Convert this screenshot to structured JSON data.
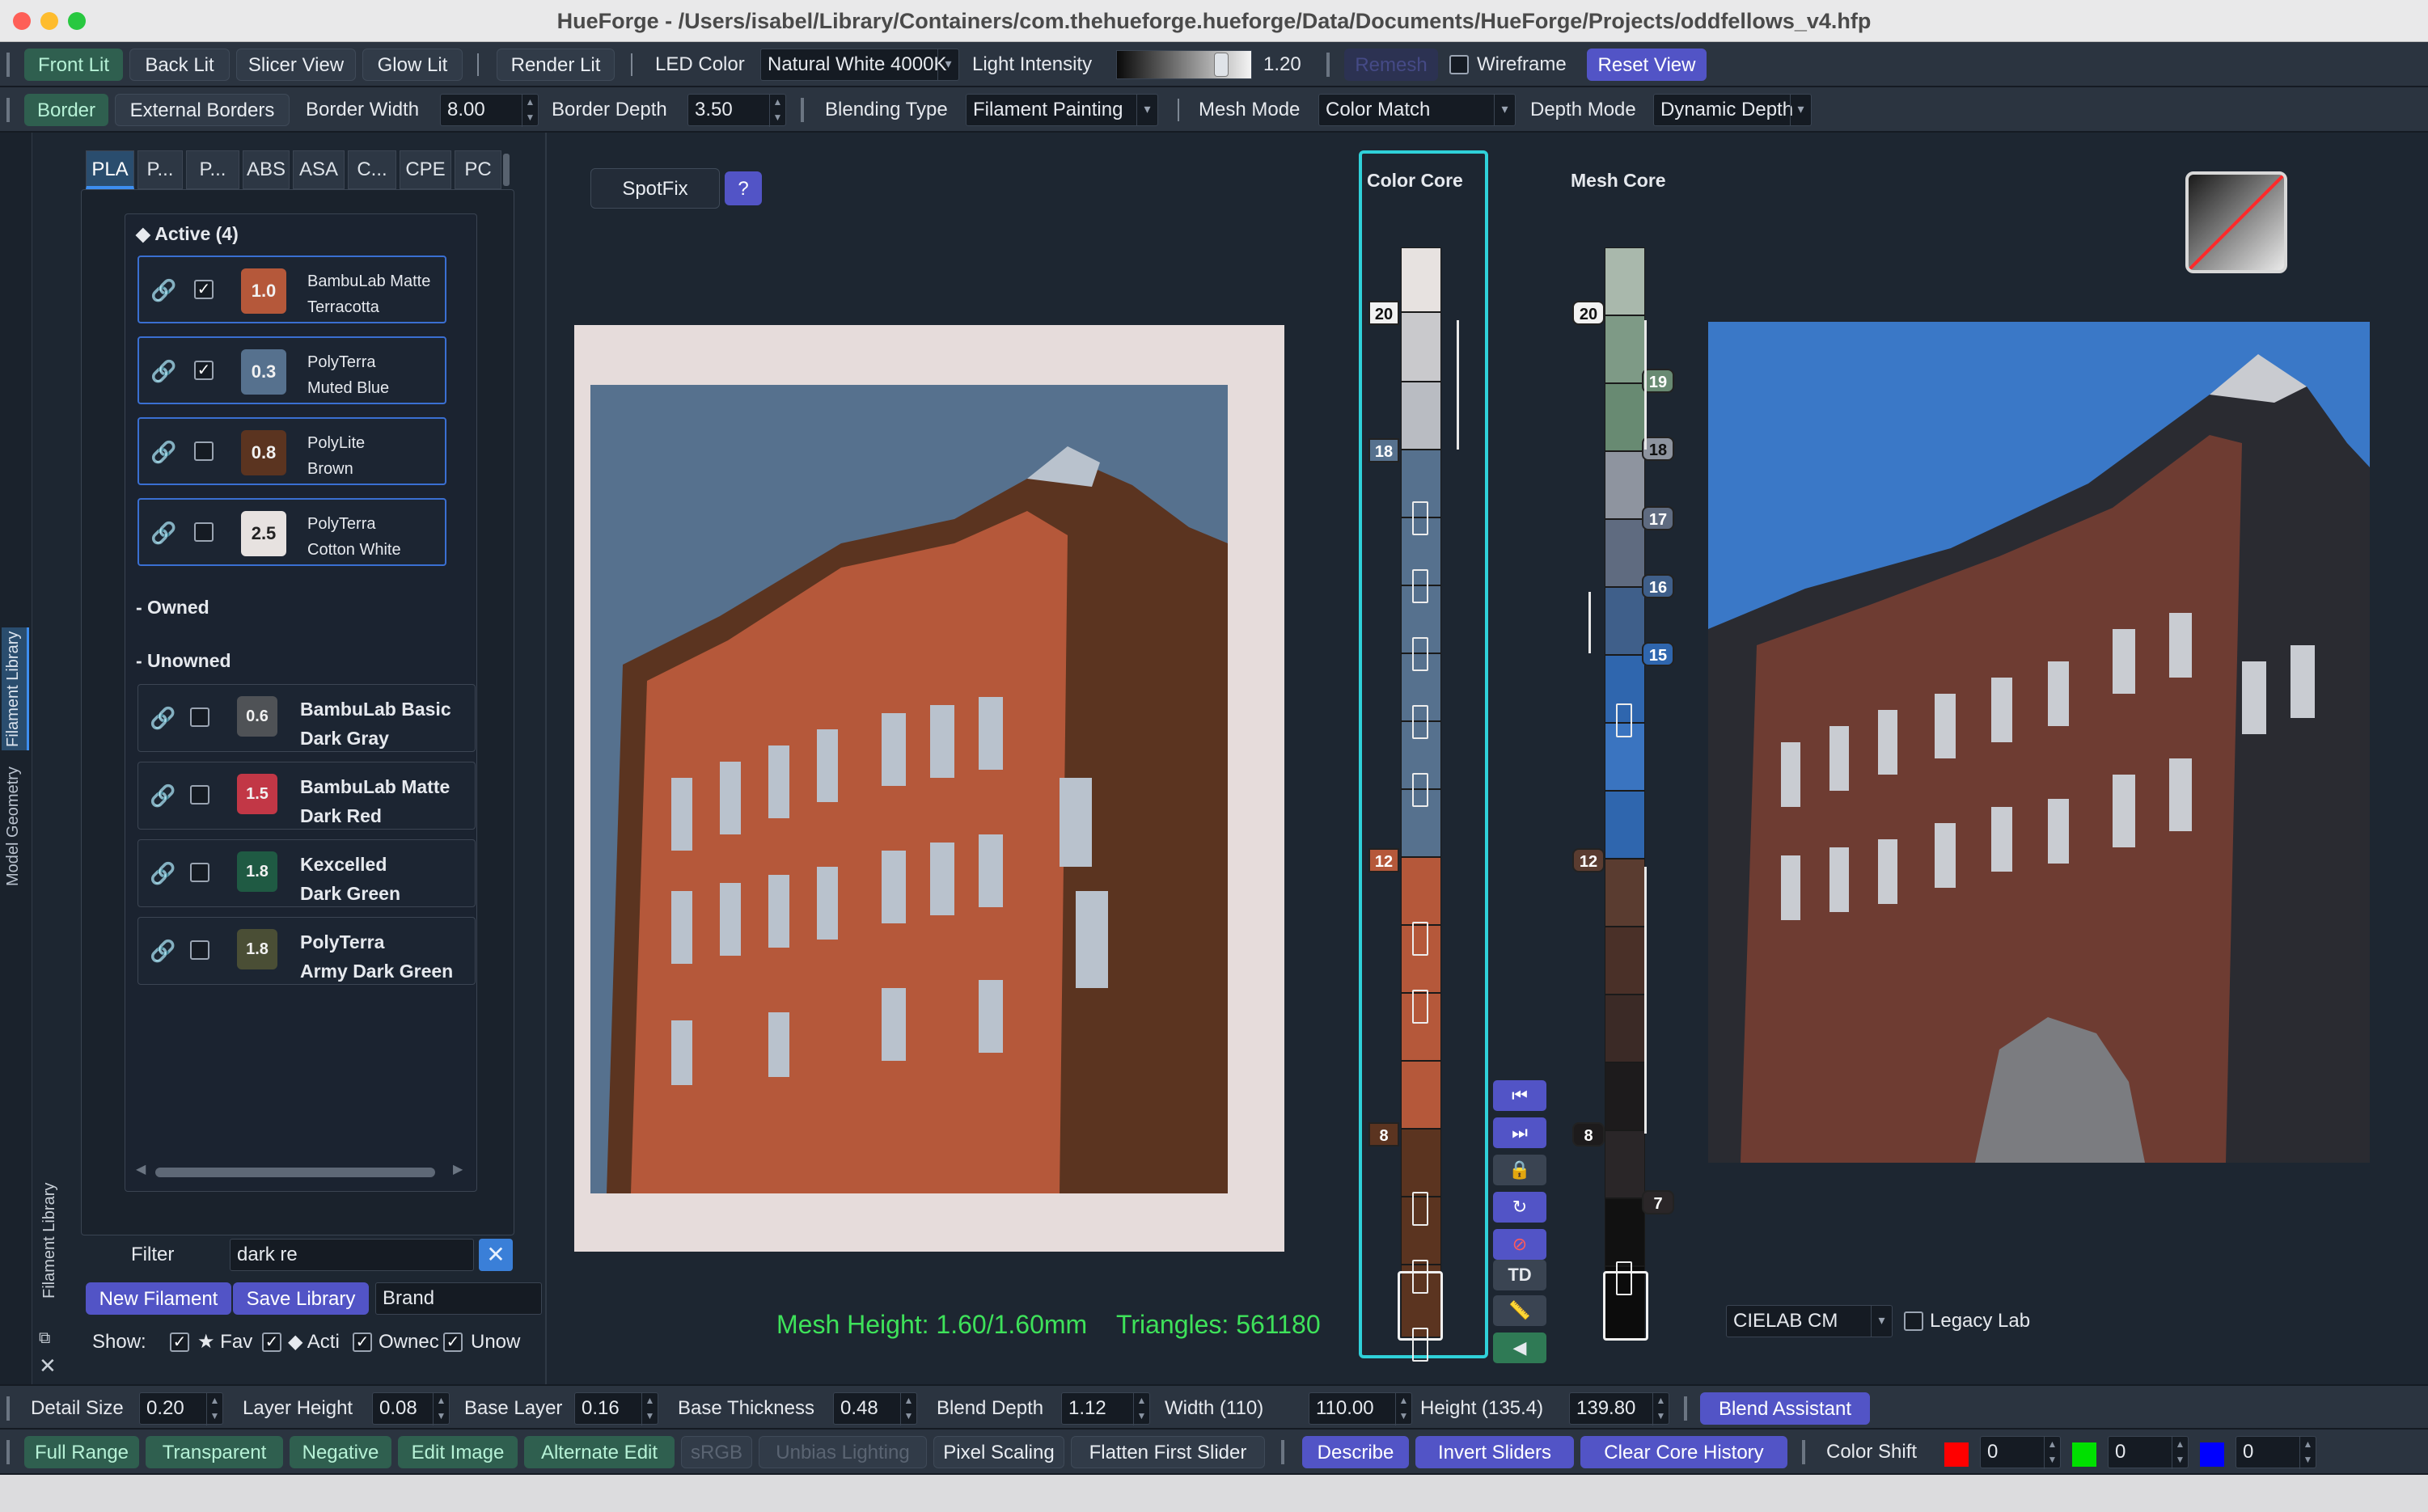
{
  "window": {
    "title": "HueForge - /Users/isabel/Library/Containers/com.thehueforge.hueforge/Data/Documents/HueForge/Projects/oddfellows_v4.hfp"
  },
  "toolbar1": {
    "front_lit": "Front Lit",
    "back_lit": "Back Lit",
    "slicer_view": "Slicer View",
    "glow_lit": "Glow Lit",
    "render_lit": "Render Lit",
    "led_color_label": "LED Color",
    "led_color_value": "Natural White 4000K",
    "light_intensity_label": "Light Intensity",
    "light_intensity_value": "1.20",
    "light_intensity_level": 0.8,
    "remesh": "Remesh",
    "wireframe": "Wireframe",
    "reset_view": "Reset View"
  },
  "toolbar2": {
    "border": "Border",
    "external_borders": "External Borders",
    "border_width_label": "Border Width",
    "border_width_value": "8.00",
    "border_depth_label": "Border Depth",
    "border_depth_value": "3.50",
    "blending_type_label": "Blending Type",
    "blending_type_value": "Filament Painting",
    "mesh_mode_label": "Mesh Mode",
    "mesh_mode_value": "Color Match",
    "depth_mode_label": "Depth Mode",
    "depth_mode_value": "Dynamic Depth"
  },
  "side_tabs": {
    "filament_library": "Filament Library",
    "model_geometry": "Model Geometry",
    "filament_library_bottom": "Filament Library"
  },
  "library": {
    "tabs": [
      "PLA",
      "P...",
      "P...",
      "ABS",
      "ASA",
      "C...",
      "CPE",
      "PC"
    ],
    "active_header": "◆ Active (4)",
    "active": [
      {
        "line1": "BambuLab Matte",
        "line2": "Terracotta",
        "td": "1.0",
        "color": "#b5583a",
        "checked": true
      },
      {
        "line1": "PolyTerra",
        "line2": "Muted Blue",
        "td": "0.3",
        "color": "#56718e",
        "checked": true
      },
      {
        "line1": "PolyLite",
        "line2": "Brown",
        "td": "0.8",
        "color": "#5b3420",
        "checked": false
      },
      {
        "line1": "PolyTerra",
        "line2": "Cotton White",
        "td": "2.5",
        "color": "#e7e2e0",
        "checked": false
      }
    ],
    "owned_header": "- Owned",
    "unowned_header": "- Unowned",
    "unowned": [
      {
        "line1": "BambuLab Basic",
        "line2": "Dark Gray",
        "td": "0.6",
        "color": "#4f5256"
      },
      {
        "line1": "BambuLab Matte",
        "line2": "Dark Red",
        "td": "1.5",
        "color": "#c23746"
      },
      {
        "line1": "Kexcelled",
        "line2": "Dark Green",
        "td": "1.8",
        "color": "#1f5a43"
      },
      {
        "line1": "PolyTerra",
        "line2": "Army Dark Green",
        "td": "1.8",
        "color": "#4a4e35"
      }
    ],
    "filter_label": "Filter",
    "filter_value": "dark re",
    "new_filament": "New Filament",
    "save_library": "Save Library",
    "brand_placeholder": "Brand",
    "show_label": "Show:",
    "show_fav": "★ Fav",
    "show_active": "◆ Acti",
    "show_owned": "Ownec",
    "show_unowned": "Unow"
  },
  "spotfix": {
    "label": "SpotFix",
    "help": "?"
  },
  "color_core": {
    "label": "Color Core",
    "markers": [
      "20",
      "18",
      "12",
      "8"
    ]
  },
  "mesh_core": {
    "label": "Mesh Core",
    "markers": [
      "20",
      "19",
      "18",
      "17",
      "16",
      "15",
      "12",
      "8",
      "7"
    ]
  },
  "status": {
    "mesh_height": "Mesh Height: 1.60/1.60mm",
    "triangles": "Triangles: 561180"
  },
  "td_button": "TD",
  "colorspace": {
    "value": "CIELAB CM",
    "legacy_lab": "Legacy Lab"
  },
  "toolbar3": {
    "detail_size_label": "Detail Size",
    "detail_size": "0.20",
    "layer_height_label": "Layer Height",
    "layer_height": "0.08",
    "base_layer_label": "Base Layer",
    "base_layer": "0.16",
    "base_thickness_label": "Base Thickness",
    "base_thickness": "0.48",
    "blend_depth_label": "Blend Depth",
    "blend_depth": "1.12",
    "width_label": "Width (110)",
    "width": "110.00",
    "height_label": "Height (135.4)",
    "height": "139.80",
    "blend_assistant": "Blend Assistant"
  },
  "toolbar4": {
    "full_range": "Full Range",
    "transparent": "Transparent",
    "negative": "Negative",
    "edit_image": "Edit Image",
    "alternate_edit": "Alternate Edit",
    "srgb": "sRGB",
    "unbias_lighting": "Unbias Lighting",
    "pixel_scaling": "Pixel Scaling",
    "flatten_first_slider": "Flatten First Slider",
    "describe": "Describe",
    "invert_sliders": "Invert Sliders",
    "clear_core_history": "Clear Core History",
    "color_shift_label": "Color Shift",
    "red": "0",
    "green": "0",
    "blue": "0"
  }
}
